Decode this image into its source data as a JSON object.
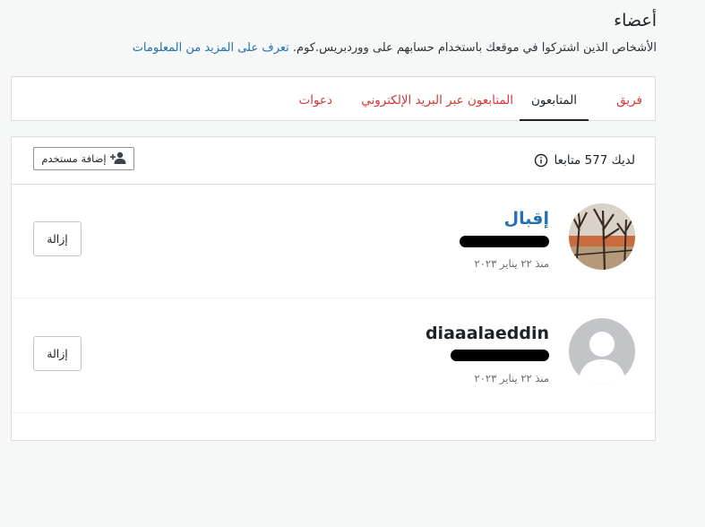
{
  "page": {
    "title": "أعضاء",
    "subtitle": "الأشخاص الذين اشتركوا في موقعك باستخدام حسابهم على ووردبريس.كوم.",
    "learn_more": "تعرف على المزيد من المعلومات"
  },
  "tabs": [
    {
      "label": "فريق",
      "active": false
    },
    {
      "label": "المتابعون",
      "active": true
    },
    {
      "label": "المتابعون عبر البريد الإلكتروني",
      "active": false
    },
    {
      "label": "دعوات",
      "active": false
    }
  ],
  "list": {
    "follower_count": "لديك 577 متابعا",
    "add_user_label": "إضافة مستخدم",
    "followers": [
      {
        "name": "إقبال",
        "since": "منذ ٢٢ يناير ٢٠٢٣",
        "remove_label": "إزالة"
      },
      {
        "name": "diaaalaeddin",
        "since": "منذ ٢٢ يناير ٢٠٢٣",
        "remove_label": "إزالة"
      }
    ]
  },
  "colors": {
    "accent_link": "#2271b1",
    "tab_inactive": "#d63638",
    "text": "#1d2327"
  },
  "icons": {
    "info": "info-icon",
    "add_user": "add-user-icon",
    "default_avatar": "default-avatar-icon"
  }
}
